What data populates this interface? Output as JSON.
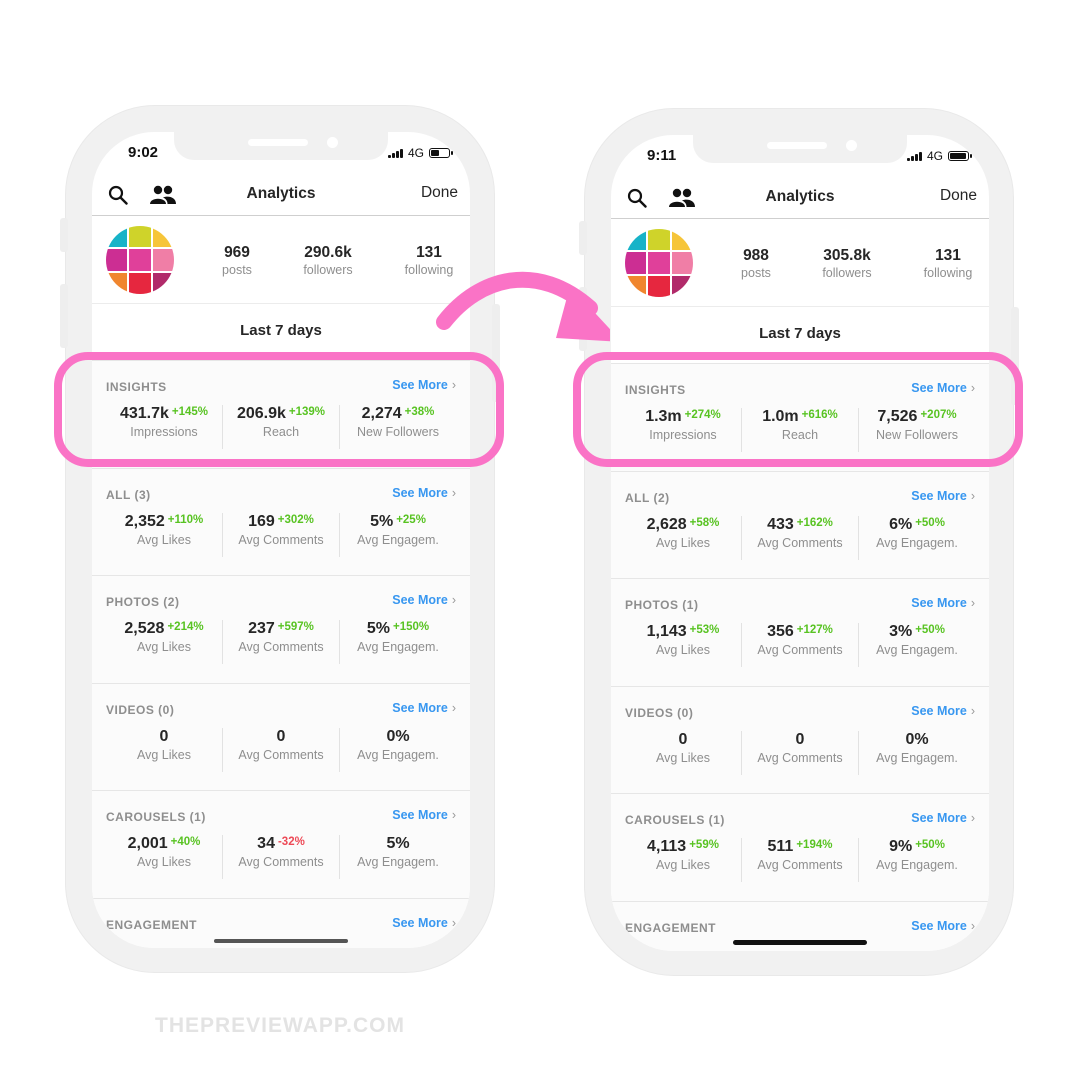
{
  "colors": {
    "accent_pink": "#fa73c6",
    "link_blue": "#3897f0",
    "positive": "#58c322",
    "negative": "#ed4956"
  },
  "avatar_colors": [
    "#17b3c8",
    "#cfd32a",
    "#f6c53a",
    "#cc2e93",
    "#e0409a",
    "#f07ea6",
    "#f0862f",
    "#e6273f",
    "#b12a6a"
  ],
  "watermark": "THEPREVIEWAPP.COM",
  "phones": [
    {
      "time": "9:02",
      "network": "4G",
      "battery_level": 0.45,
      "nav": {
        "title": "Analytics",
        "done": "Done"
      },
      "profile": {
        "posts": {
          "value": "969",
          "label": "posts"
        },
        "followers": {
          "value": "290.6k",
          "label": "followers"
        },
        "following": {
          "value": "131",
          "label": "following"
        }
      },
      "period": "Last 7 days",
      "sections": [
        {
          "title": "INSIGHTS",
          "see_more": "See More",
          "cells": [
            {
              "value": "431.7k",
              "change": "+145%",
              "label": "Impressions"
            },
            {
              "value": "206.9k",
              "change": "+139%",
              "label": "Reach"
            },
            {
              "value": "2,274",
              "change": "+38%",
              "label": "New Followers"
            }
          ]
        },
        {
          "title": "ALL (3)",
          "see_more": "See More",
          "cells": [
            {
              "value": "2,352",
              "change": "+110%",
              "label": "Avg Likes"
            },
            {
              "value": "169",
              "change": "+302%",
              "label": "Avg Comments"
            },
            {
              "value": "5%",
              "change": "+25%",
              "label": "Avg Engagem."
            }
          ]
        },
        {
          "title": "PHOTOS (2)",
          "see_more": "See More",
          "cells": [
            {
              "value": "2,528",
              "change": "+214%",
              "label": "Avg Likes"
            },
            {
              "value": "237",
              "change": "+597%",
              "label": "Avg Comments"
            },
            {
              "value": "5%",
              "change": "+150%",
              "label": "Avg Engagem."
            }
          ]
        },
        {
          "title": "VIDEOS (0)",
          "see_more": "See More",
          "cells": [
            {
              "value": "0",
              "change": "",
              "label": "Avg Likes"
            },
            {
              "value": "0",
              "change": "",
              "label": "Avg Comments"
            },
            {
              "value": "0%",
              "change": "",
              "label": "Avg Engagem."
            }
          ]
        },
        {
          "title": "CAROUSELS (1)",
          "see_more": "See More",
          "cells": [
            {
              "value": "2,001",
              "change": "+40%",
              "label": "Avg Likes"
            },
            {
              "value": "34",
              "change": "-32%",
              "label": "Avg Comments"
            },
            {
              "value": "5%",
              "change": "",
              "label": "Avg Engagem."
            }
          ]
        },
        {
          "title": "ENGAGEMENT",
          "see_more": "See More",
          "cells": []
        }
      ]
    },
    {
      "time": "9:11",
      "network": "4G",
      "battery_level": 0.95,
      "nav": {
        "title": "Analytics",
        "done": "Done"
      },
      "profile": {
        "posts": {
          "value": "988",
          "label": "posts"
        },
        "followers": {
          "value": "305.8k",
          "label": "followers"
        },
        "following": {
          "value": "131",
          "label": "following"
        }
      },
      "period": "Last 7 days",
      "sections": [
        {
          "title": "INSIGHTS",
          "see_more": "See More",
          "cells": [
            {
              "value": "1.3m",
              "change": "+274%",
              "label": "Impressions"
            },
            {
              "value": "1.0m",
              "change": "+616%",
              "label": "Reach"
            },
            {
              "value": "7,526",
              "change": "+207%",
              "label": "New Followers"
            }
          ]
        },
        {
          "title": "ALL (2)",
          "see_more": "See More",
          "cells": [
            {
              "value": "2,628",
              "change": "+58%",
              "label": "Avg Likes"
            },
            {
              "value": "433",
              "change": "+162%",
              "label": "Avg Comments"
            },
            {
              "value": "6%",
              "change": "+50%",
              "label": "Avg Engagem."
            }
          ]
        },
        {
          "title": "PHOTOS (1)",
          "see_more": "See More",
          "cells": [
            {
              "value": "1,143",
              "change": "+53%",
              "label": "Avg Likes"
            },
            {
              "value": "356",
              "change": "+127%",
              "label": "Avg Comments"
            },
            {
              "value": "3%",
              "change": "+50%",
              "label": "Avg Engagem."
            }
          ]
        },
        {
          "title": "VIDEOS (0)",
          "see_more": "See More",
          "cells": [
            {
              "value": "0",
              "change": "",
              "label": "Avg Likes"
            },
            {
              "value": "0",
              "change": "",
              "label": "Avg Comments"
            },
            {
              "value": "0%",
              "change": "",
              "label": "Avg Engagem."
            }
          ]
        },
        {
          "title": "CAROUSELS (1)",
          "see_more": "See More",
          "cells": [
            {
              "value": "4,113",
              "change": "+59%",
              "label": "Avg Likes"
            },
            {
              "value": "511",
              "change": "+194%",
              "label": "Avg Comments"
            },
            {
              "value": "9%",
              "change": "+50%",
              "label": "Avg Engagem."
            }
          ]
        },
        {
          "title": "ENGAGEMENT",
          "see_more": "See More",
          "cells": []
        }
      ]
    }
  ]
}
